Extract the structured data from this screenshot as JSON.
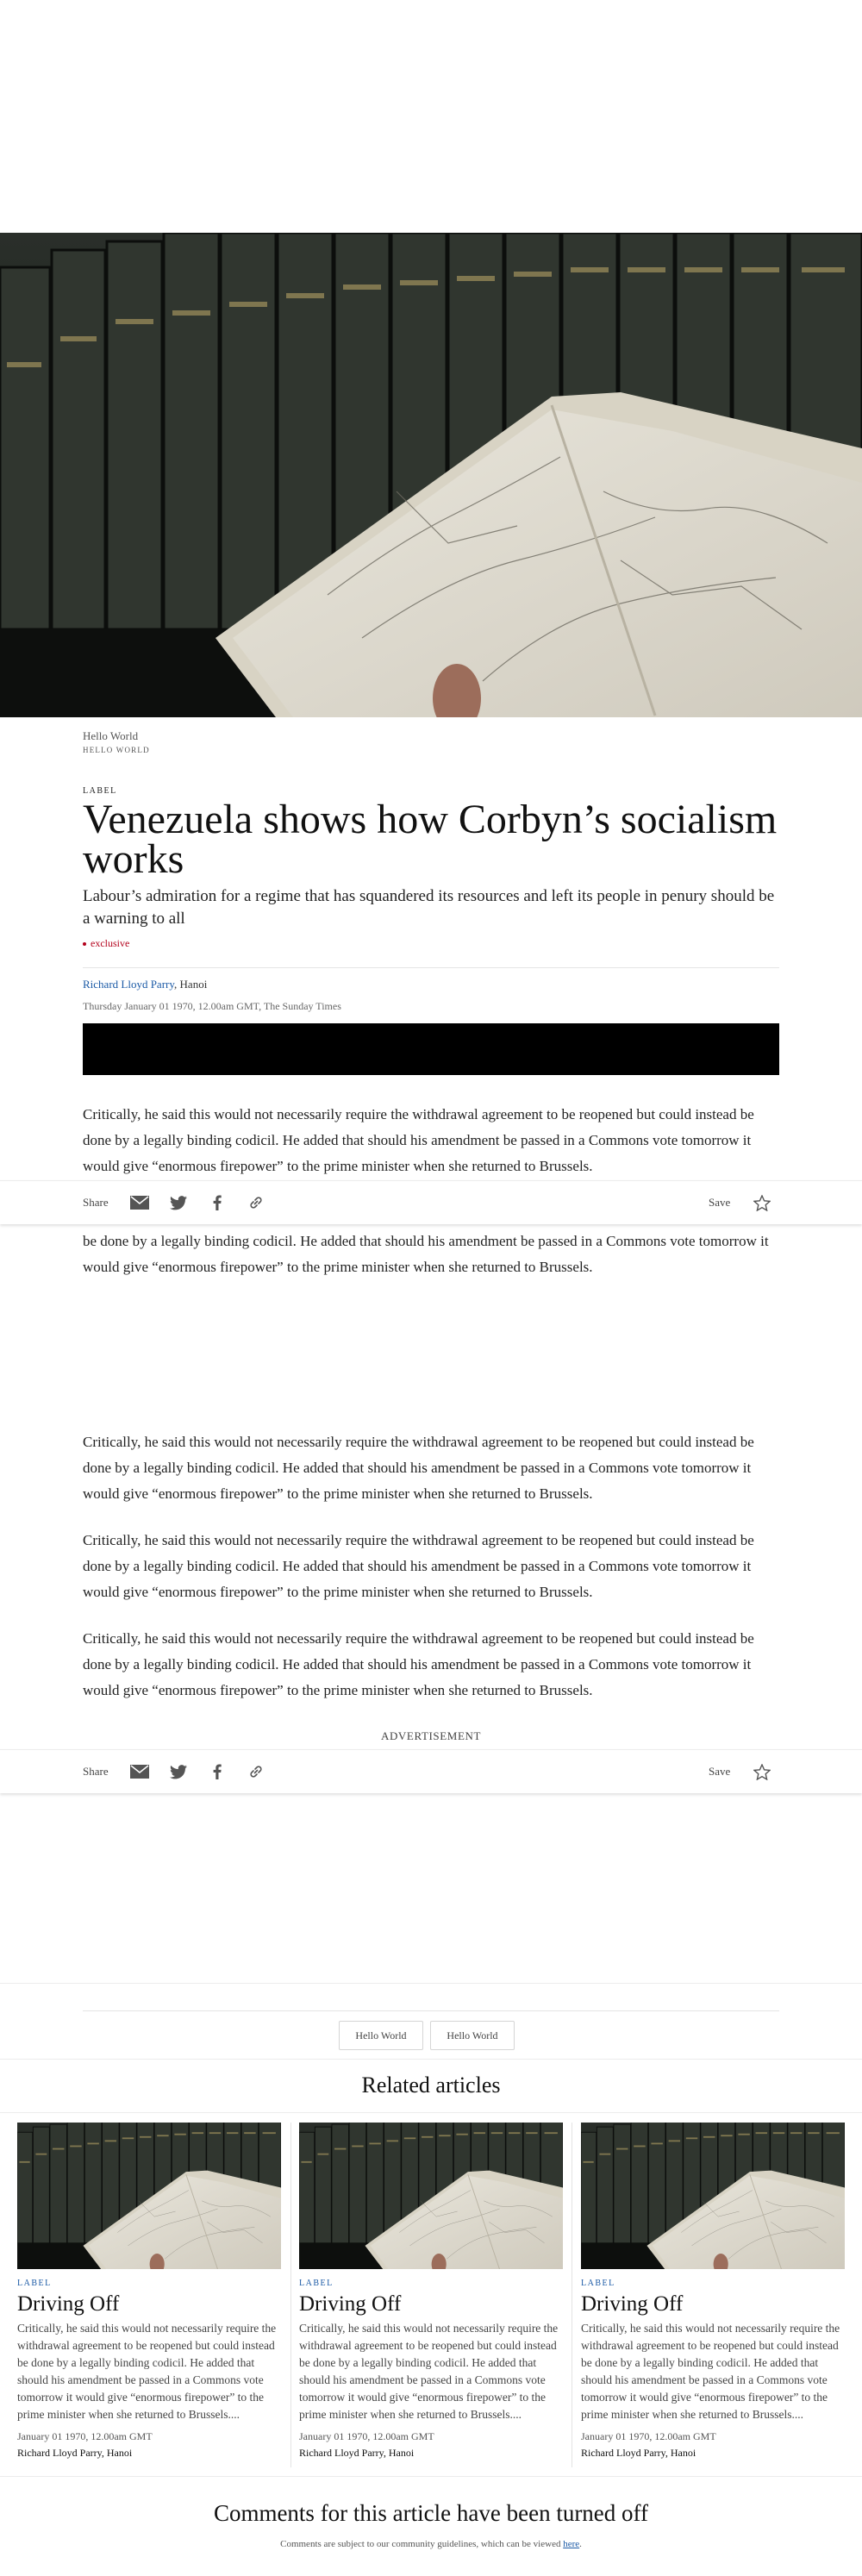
{
  "hero": {
    "image": "open-atlas-in-front-of-bookshelf",
    "caption": "Hello World",
    "credit": "HELLO WORLD"
  },
  "article": {
    "label": "LABEL",
    "headline": "Venezuela shows how Corbyn’s socialism works",
    "standfirst": "Labour’s admiration for a regime that has squandered its resources and left its people in penury should be a warning to all",
    "flag": "exclusive",
    "author": "Richard Lloyd Parry",
    "location": ", Hanoi",
    "dateline": "Thursday January 01 1970, 12.00am GMT, The Sunday Times",
    "paragraph": "Critically, he said this would not necessarily require the withdrawal agreement to be reopened but could instead be done by a legally binding codicil. He added that should his amendment be passed in a Commons vote tomorrow it would give “enormous firepower” to the prime minister when she returned to Brussels.",
    "paragraph_fragment": "be done by a legally binding codicil. He added that should his amendment be passed in a Commons vote tomorrow it would give “enormous firepower” to the prime minister when she returned to Brussels."
  },
  "sharebar": {
    "share_label": "Share",
    "save_label": "Save",
    "icons": [
      "mail-icon",
      "twitter-icon",
      "facebook-icon",
      "link-icon",
      "star-icon"
    ]
  },
  "advertisement_label": "ADVERTISEMENT",
  "tags": [
    "Hello World",
    "Hello World"
  ],
  "related": {
    "title": "Related articles",
    "items": [
      {
        "label": "LABEL",
        "title": "Driving Off",
        "summary": "Critically, he said this would not necessarily require the withdrawal agreement to be reopened but could instead be done by a legally binding codicil. He added that should his amendment be passed in a Commons vote tomorrow it would give “enormous firepower” to the prime minister when she returned to Brussels....",
        "date": "January 01 1970, 12.00am GMT",
        "author": "Richard Lloyd Parry, Hanoi"
      },
      {
        "label": "LABEL",
        "title": "Driving Off",
        "summary": "Critically, he said this would not necessarily require the withdrawal agreement to be reopened but could instead be done by a legally binding codicil. He added that should his amendment be passed in a Commons vote tomorrow it would give “enormous firepower” to the prime minister when she returned to Brussels....",
        "date": "January 01 1970, 12.00am GMT",
        "author": "Richard Lloyd Parry, Hanoi"
      },
      {
        "label": "LABEL",
        "title": "Driving Off",
        "summary": "Critically, he said this would not necessarily require the withdrawal agreement to be reopened but could instead be done by a legally binding codicil. He added that should his amendment be passed in a Commons vote tomorrow it would give “enormous firepower” to the prime minister when she returned to Brussels....",
        "date": "January 01 1970, 12.00am GMT",
        "author": "Richard Lloyd Parry, Hanoi"
      }
    ]
  },
  "comments": {
    "title": "Comments for this article have been turned off",
    "note": "Comments are subject to our community guidelines, which can be viewed ",
    "link_text": "here",
    "note_end": "."
  },
  "colors": {
    "link": "#1b5aa6",
    "exclusive": "#b3001b",
    "text": "#222222"
  }
}
